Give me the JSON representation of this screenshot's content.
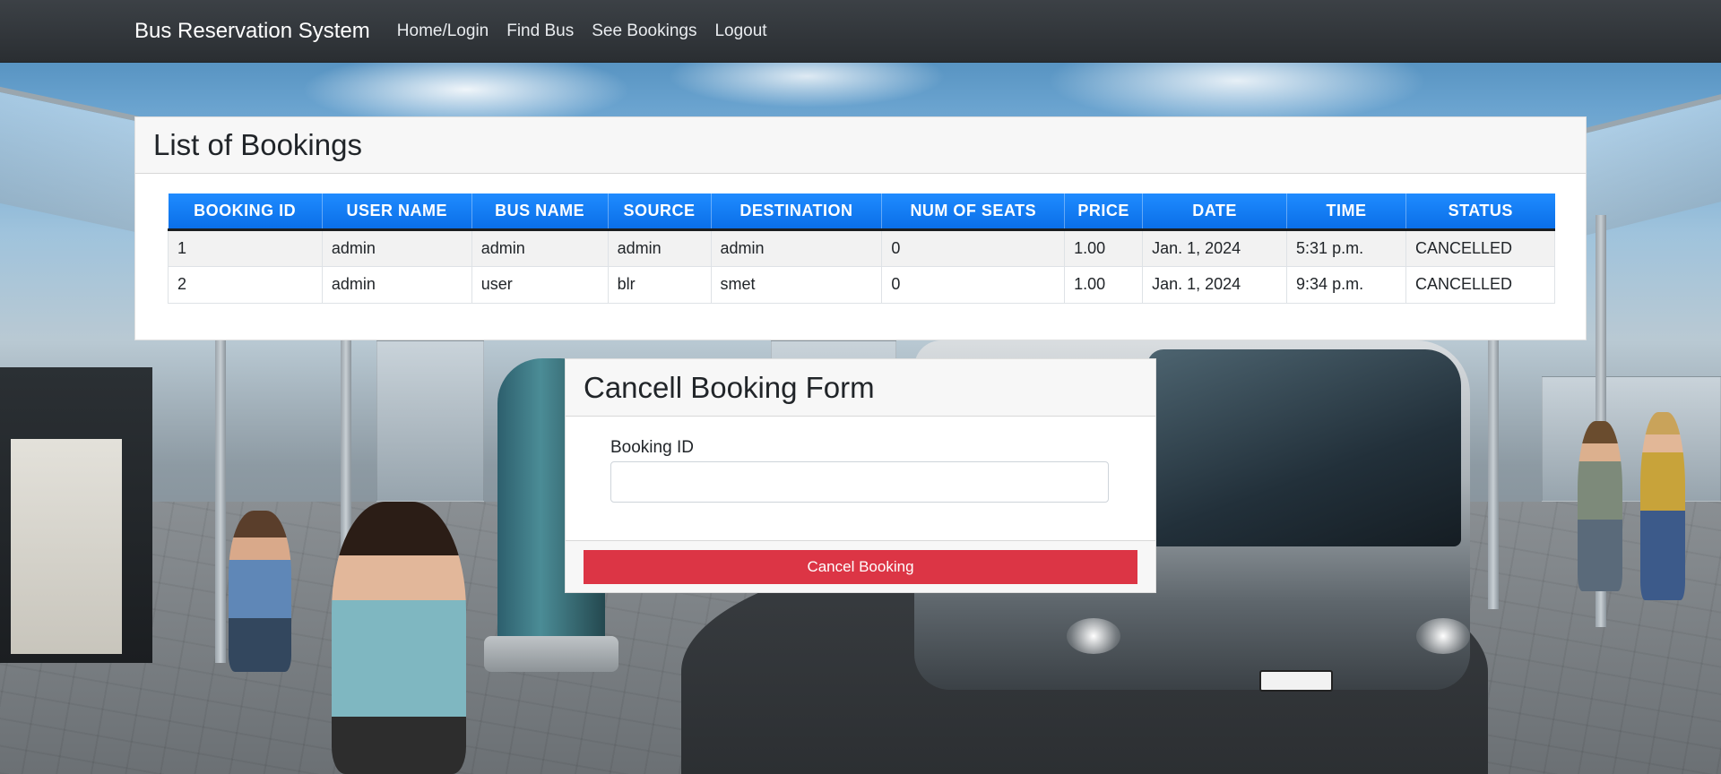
{
  "nav": {
    "brand": "Bus Reservation System",
    "links": [
      "Home/Login",
      "Find Bus",
      "See Bookings",
      "Logout"
    ]
  },
  "bookings": {
    "title": "List of Bookings",
    "columns": [
      "BOOKING ID",
      "USER NAME",
      "BUS NAME",
      "SOURCE",
      "DESTINATION",
      "NUM OF SEATS",
      "PRICE",
      "DATE",
      "TIME",
      "STATUS"
    ],
    "rows": [
      [
        "1",
        "admin",
        "admin",
        "admin",
        "admin",
        "0",
        "1.00",
        "Jan. 1, 2024",
        "5:31 p.m.",
        "CANCELLED"
      ],
      [
        "2",
        "admin",
        "user",
        "blr",
        "smet",
        "0",
        "1.00",
        "Jan. 1, 2024",
        "9:34 p.m.",
        "CANCELLED"
      ]
    ],
    "header_color": "#0d6efd"
  },
  "cancel_form": {
    "title": "Cancell Booking Form",
    "booking_id_label": "Booking ID",
    "booking_id_value": "",
    "submit_label": "Cancel Booking",
    "button_color": "#dc3545"
  }
}
